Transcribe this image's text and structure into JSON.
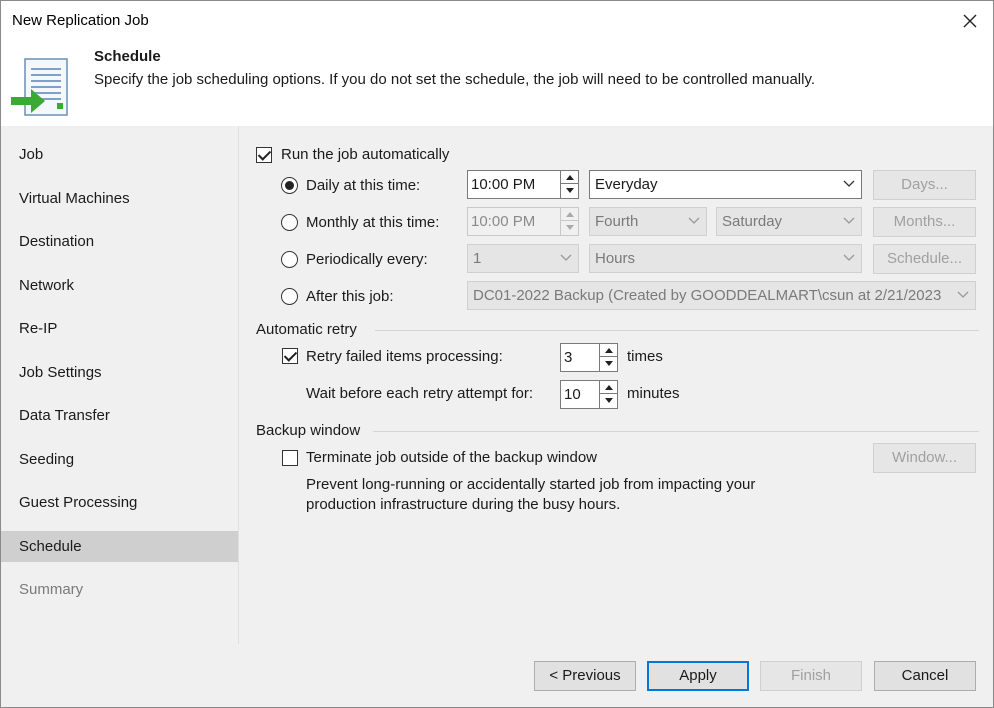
{
  "window": {
    "title": "New Replication Job"
  },
  "header": {
    "title": "Schedule",
    "description": "Specify the job scheduling options. If you do not set the schedule, the job will need to be controlled manually."
  },
  "sidebar": {
    "items": [
      {
        "label": "Job"
      },
      {
        "label": "Virtual Machines"
      },
      {
        "label": "Destination"
      },
      {
        "label": "Network"
      },
      {
        "label": "Re-IP"
      },
      {
        "label": "Job Settings"
      },
      {
        "label": "Data Transfer"
      },
      {
        "label": "Seeding"
      },
      {
        "label": "Guest Processing"
      },
      {
        "label": "Schedule"
      },
      {
        "label": "Summary"
      }
    ],
    "active": "Schedule"
  },
  "schedule": {
    "run_auto_label": "Run the job automatically",
    "run_auto_checked": true,
    "daily": {
      "label": "Daily at this time:",
      "time": "10:00 PM",
      "option": "Everyday",
      "button": "Days...",
      "selected": true
    },
    "monthly": {
      "label": "Monthly at this time:",
      "time": "10:00 PM",
      "week": "Fourth",
      "day": "Saturday",
      "button": "Months..."
    },
    "periodic": {
      "label": "Periodically every:",
      "value": "1",
      "unit": "Hours",
      "button": "Schedule..."
    },
    "after": {
      "label": "After this job:",
      "job": "DC01-2022 Backup (Created by GOODDEALMART\\csun at 2/21/2023"
    }
  },
  "retry": {
    "group_label": "Automatic retry",
    "retry_label": "Retry failed items processing:",
    "retry_checked": true,
    "retry_count": "3",
    "times_label": "times",
    "wait_label": "Wait before each retry attempt for:",
    "wait_value": "10",
    "minutes_label": "minutes"
  },
  "backup_window": {
    "group_label": "Backup window",
    "terminate_label": "Terminate job outside of the backup window",
    "terminate_checked": false,
    "window_button": "Window...",
    "description_line1": "Prevent long-running or accidentally started job from impacting your",
    "description_line2": "production infrastructure during the busy hours."
  },
  "footer": {
    "previous": "< Previous",
    "apply": "Apply",
    "finish": "Finish",
    "cancel": "Cancel"
  }
}
